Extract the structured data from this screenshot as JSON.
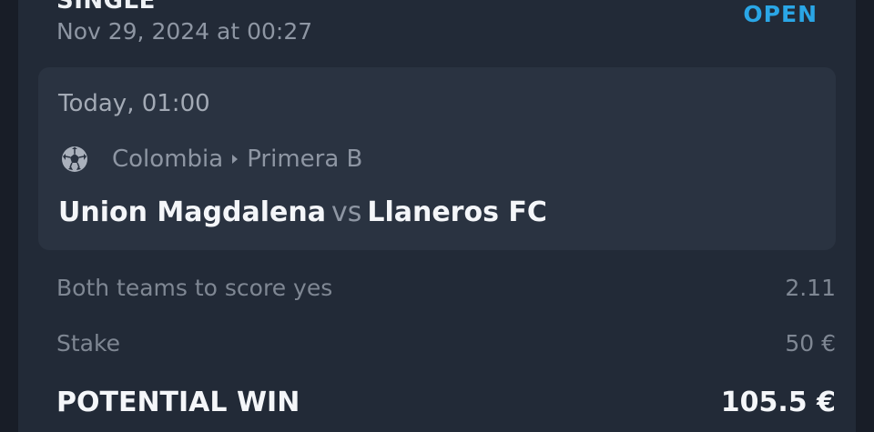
{
  "bet": {
    "type": "SINGLE",
    "status": "OPEN",
    "placed_at": "Nov 29, 2024 at 00:27"
  },
  "event": {
    "kickoff": "Today, 01:00",
    "sport_icon": "soccer-ball-icon",
    "country": "Colombia",
    "league": "Primera B",
    "home_team": "Union Magdalena",
    "vs": "vs",
    "away_team": "Llaneros FC"
  },
  "selection": {
    "market": "Both teams to score yes",
    "odds": "2.11"
  },
  "stake": {
    "label": "Stake",
    "value": "50 €"
  },
  "potential_win": {
    "label": "POTENTIAL WIN",
    "value": "105.5 €"
  },
  "colors": {
    "background": "#181d27",
    "card": "#222a37",
    "event_box": "#2a3341",
    "status_accent": "#2aa6e6"
  }
}
